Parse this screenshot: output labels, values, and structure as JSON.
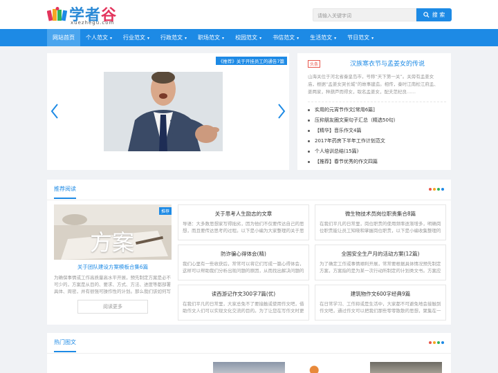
{
  "header": {
    "logo_text": "学者",
    "logo_text_accent": "谷",
    "logo_url": "xuezhegu.com",
    "search_placeholder": "请输入关键字词",
    "search_button": "搜 索"
  },
  "nav": {
    "items": [
      {
        "label": "网站首页",
        "caret": false
      },
      {
        "label": "个人范文",
        "caret": true
      },
      {
        "label": "行业范文",
        "caret": true
      },
      {
        "label": "行政范文",
        "caret": true
      },
      {
        "label": "职场范文",
        "caret": true
      },
      {
        "label": "校园范文",
        "caret": true
      },
      {
        "label": "书信范文",
        "caret": true
      },
      {
        "label": "生活范文",
        "caret": true
      },
      {
        "label": "节日范文",
        "caret": true
      }
    ],
    "caret_glyph": "▾"
  },
  "slider": {
    "tag": "《推荐》关于开挂员工的通告7篇"
  },
  "feature": {
    "badge": "头条",
    "title": "汉族寒衣节与孟姜女的传说",
    "summary": "山海关位于河北省秦皇岛市，号称“天下第一关”。关旁有孟姜女庙，根据“孟姜女哭长城”的故事建造。相传，秦时江南松江府孟、姜两家，种葫芦而得女，取名孟姜女，配夫范杞良……",
    "list": [
      "实用的元宵节作文[常用6篇]",
      "压抑朋友圈文案句子汇总（精选50句）",
      "【精华】音乐作文4篇",
      "2017年药房下半年工作计划范文",
      "个人培训总结(15篇)",
      "【推荐】春节优秀的作文四篇"
    ]
  },
  "recommend": {
    "title": "推荐阅读",
    "dot_colors": [
      "#e8554a",
      "#f5a623",
      "#2fb35a",
      "#1d8ae5"
    ],
    "main": {
      "image_text": "方案",
      "tag": "推荐",
      "title": "关于团队建设方案模板合集6篇",
      "desc": "为确保事情或工作高质量高水平开展，预先制定方案是必不可少的，方案是从目的、要求、方式、方法、进度等都部署具体、周密，并有很强可操作性的计划。那么我们该如何写一篇较为完美的方案呢？",
      "more": "阅读更多"
    },
    "cards": [
      {
        "title": "关于思考人生励志的文章",
        "desc": "导语：大多数思想家写得拙劣，因为他们不仅要传达自己的思想，而且要传达思考的过程。以下是小编为大家整理的关于思考人生励志的文章"
      },
      {
        "title": "微生物技术员岗位职责集合8篇",
        "desc": "在我们平凡的日常里，岗位职责的使用频率逐渐增多，明确岗位职责能让员工知晓和掌握岗位职责，以下是小编收集整理的微生物技术员"
      },
      {
        "title": "防诈骗心得体会(精)",
        "desc": "我们心里有一些收获后，常常可以将它们写成一篇心得体会，这样可以帮助我们分析出现问题的原因，从而找出解决问题的办法。那么心得体会"
      },
      {
        "title": "全国安全生产月的活动方案(12篇)",
        "desc": "为了确定工作或事情顺利开展，常常要根据具体情况预先制定方案，方案指的是为某一次行动所制定的计划类文书。方案应该怎么制定呢"
      },
      {
        "title": "读西游记作文300字7篇(优)",
        "desc": "在我们平凡的日常里，大家总免不了要接触或使用作文吧，借助作文人们可以实现文化交流的目的。为了让您在写作文时更加简单方便"
      },
      {
        "title": "建筑物作文600字经典9篇",
        "desc": "在日常学习、工作抑或是生活中，大家都不可避免地会接触到作文吧，通过作文可以把我们那些零零散散的思想，聚集在一块"
      }
    ]
  },
  "hot": {
    "title": "热门图文",
    "dot_colors": [
      "#e8554a",
      "#f5a623",
      "#2fb35a",
      "#1d8ae5"
    ]
  }
}
